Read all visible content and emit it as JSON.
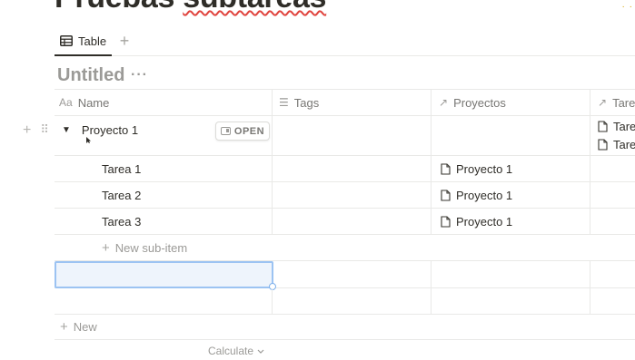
{
  "page": {
    "title_part1": "Pruebas",
    "title_part2": "subtareas"
  },
  "views": {
    "active_tab": "Table",
    "add_view": "+"
  },
  "database": {
    "title": "Untitled",
    "more": "···"
  },
  "columns": [
    {
      "icon": "Aa",
      "label": "Name"
    },
    {
      "icon": "☰",
      "label": "Tags"
    },
    {
      "icon": "↗",
      "label": "Proyectos"
    },
    {
      "icon": "↗",
      "label": "Tare"
    }
  ],
  "parent_row": {
    "name": "Proyecto 1",
    "open_label": "OPEN",
    "tareas": [
      "Tare",
      "Tare"
    ]
  },
  "sub_rows": [
    {
      "name": "Tarea 1",
      "proyecto": "Proyecto 1"
    },
    {
      "name": "Tarea 2",
      "proyecto": "Proyecto 1"
    },
    {
      "name": "Tarea 3",
      "proyecto": "Proyecto 1"
    }
  ],
  "new_sub_item": "New sub-item",
  "new_row": "New",
  "calculate": "Calculate",
  "colors": {
    "accent_selection": "#9cc3f2",
    "muted_text": "#9b9a97",
    "spell_underline": "#e0443e"
  }
}
